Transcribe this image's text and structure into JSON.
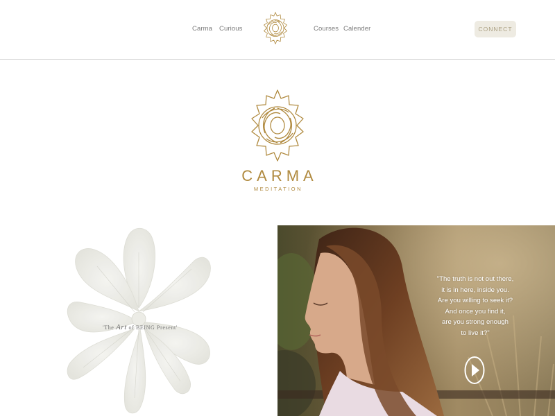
{
  "header": {
    "nav_left": [
      "Carma",
      "Curious"
    ],
    "nav_right": [
      "Courses",
      "Calender"
    ],
    "connect_label": "CONNECT",
    "logo_icon": "lotus-mandala-icon"
  },
  "hero": {
    "brand_name": "CARMA",
    "brand_subtitle": "MEDITATION",
    "logo_icon": "lotus-mandala-icon"
  },
  "feature": {
    "caption_pre": "'The ",
    "caption_art": "Art",
    "caption_post": " of BEING Present'",
    "image": "white-flower"
  },
  "video": {
    "quote_lines": [
      "\"The truth is not out there,",
      "it is in here, inside you.",
      "Are you willing to seek it?",
      "And once you find it,",
      "are you strong enough",
      "to live it?\""
    ],
    "play_icon": "play-icon",
    "image": "meditating-woman"
  },
  "colors": {
    "gold": "#b08a3f",
    "connect_bg": "#eeebe2",
    "connect_text": "#a99e7f",
    "nav_text": "#7a7a7a"
  }
}
